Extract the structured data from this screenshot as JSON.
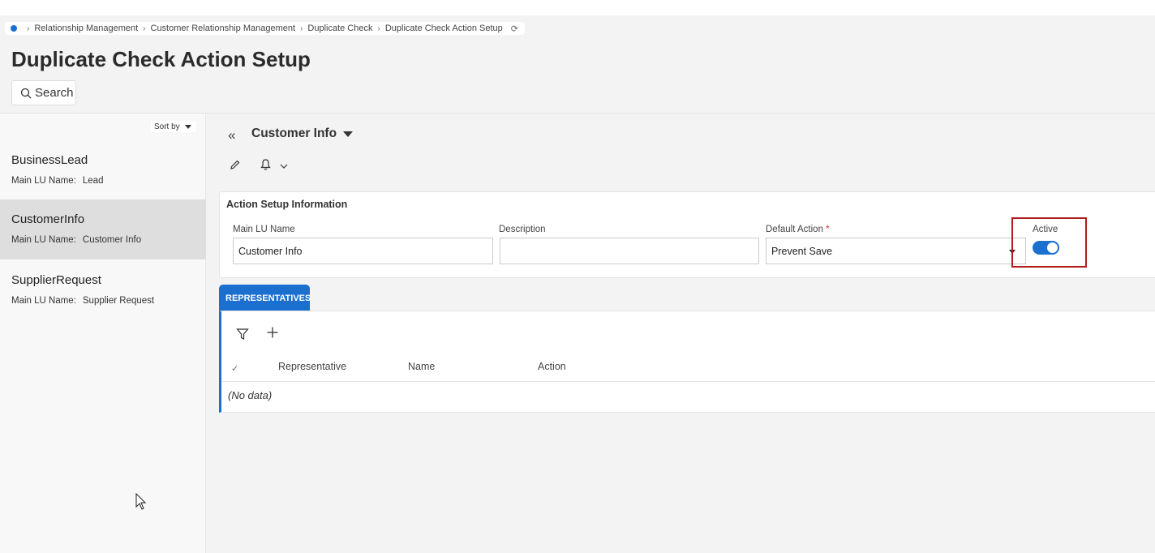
{
  "breadcrumb": {
    "items": [
      "Relationship Management",
      "Customer Relationship Management",
      "Duplicate Check",
      "Duplicate Check Action Setup"
    ],
    "refresh_icon": "refresh-icon"
  },
  "page": {
    "title": "Duplicate Check Action Setup",
    "search_label": "Search"
  },
  "sidebar": {
    "sort_label": "Sort by",
    "items": [
      {
        "title": "BusinessLead",
        "sub_label": "Main LU Name:",
        "sub_value": "Lead"
      },
      {
        "title": "CustomerInfo",
        "sub_label": "Main LU Name:",
        "sub_value": "Customer Info"
      },
      {
        "title": "SupplierRequest",
        "sub_label": "Main LU Name:",
        "sub_value": "Supplier Request"
      }
    ],
    "selected_index": 1
  },
  "record": {
    "title": "Customer Info"
  },
  "card": {
    "title": "Action Setup Information",
    "fields": {
      "main_lu_label": "Main LU Name",
      "main_lu_value": "Customer Info",
      "description_label": "Description",
      "description_value": "",
      "default_action_label": "Default Action",
      "default_action_required": "*",
      "default_action_value": "Prevent Save",
      "active_label": "Active",
      "active_on": true
    }
  },
  "tabs": {
    "representatives_label": "REPRESENTATIVES"
  },
  "grid": {
    "columns": [
      "Representative",
      "Name",
      "Action"
    ],
    "empty_text": "(No data)"
  },
  "colors": {
    "accent": "#1a6fcf",
    "highlight_box": "#b01c1c",
    "required": "#d02b2b"
  }
}
